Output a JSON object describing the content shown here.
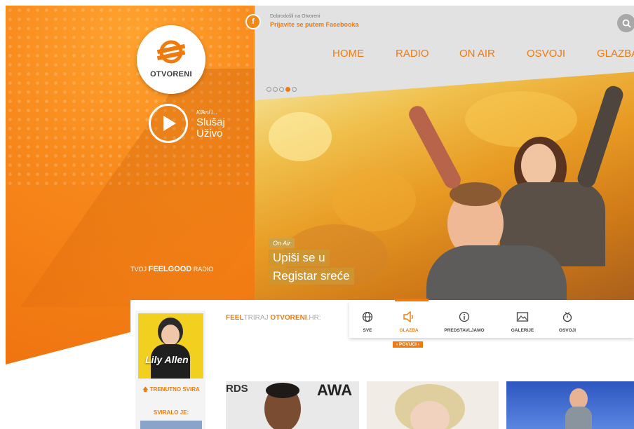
{
  "header": {
    "welcome": "Dobrodošli na Otvoreni",
    "facebook_login": "Prijavite se putem Facebooka",
    "nav": [
      "HOME",
      "RADIO",
      "ON AIR",
      "OSVOJI",
      "GLAZBA"
    ]
  },
  "brand": {
    "logo_text": "OTVORENI",
    "play_hint": "Klikni i...",
    "play_line1": "Slušaj",
    "play_line2": "Uživo",
    "tagline_pre": "TVOJ",
    "tagline_bold": "FEELGOOD",
    "tagline_post": "RADIO"
  },
  "hero": {
    "tag": "On Air",
    "line1": "Upiši se u",
    "line2": "Registar sreće",
    "slides_total": 5,
    "active_slide": 4
  },
  "content": {
    "feel_pre": "FEEL",
    "feel_mid": "TRIRAJ ",
    "feel_bold": "OTVORENI",
    "feel_post": ".HR:",
    "categories": [
      {
        "icon": "globe-icon",
        "label": "SVE"
      },
      {
        "icon": "speaker-icon",
        "label": "GLAZBA"
      },
      {
        "icon": "info-icon",
        "label": "PREDSTAVLJAMO"
      },
      {
        "icon": "gallery-icon",
        "label": "GALERIJE"
      },
      {
        "icon": "gift-icon",
        "label": "OSVOJI"
      }
    ],
    "active_category": 1,
    "pull_label": "‹ POVUCI ›",
    "now_playing_label": "TRENUTNO SVIRA",
    "played_label": "SVIRALO JE:",
    "album_artist": "Lily Allen",
    "thumb1_text_a": "RDS",
    "thumb1_text_b": "AWA"
  },
  "colors": {
    "accent": "#ef7b10",
    "header_bg": "#e2e2e2"
  }
}
